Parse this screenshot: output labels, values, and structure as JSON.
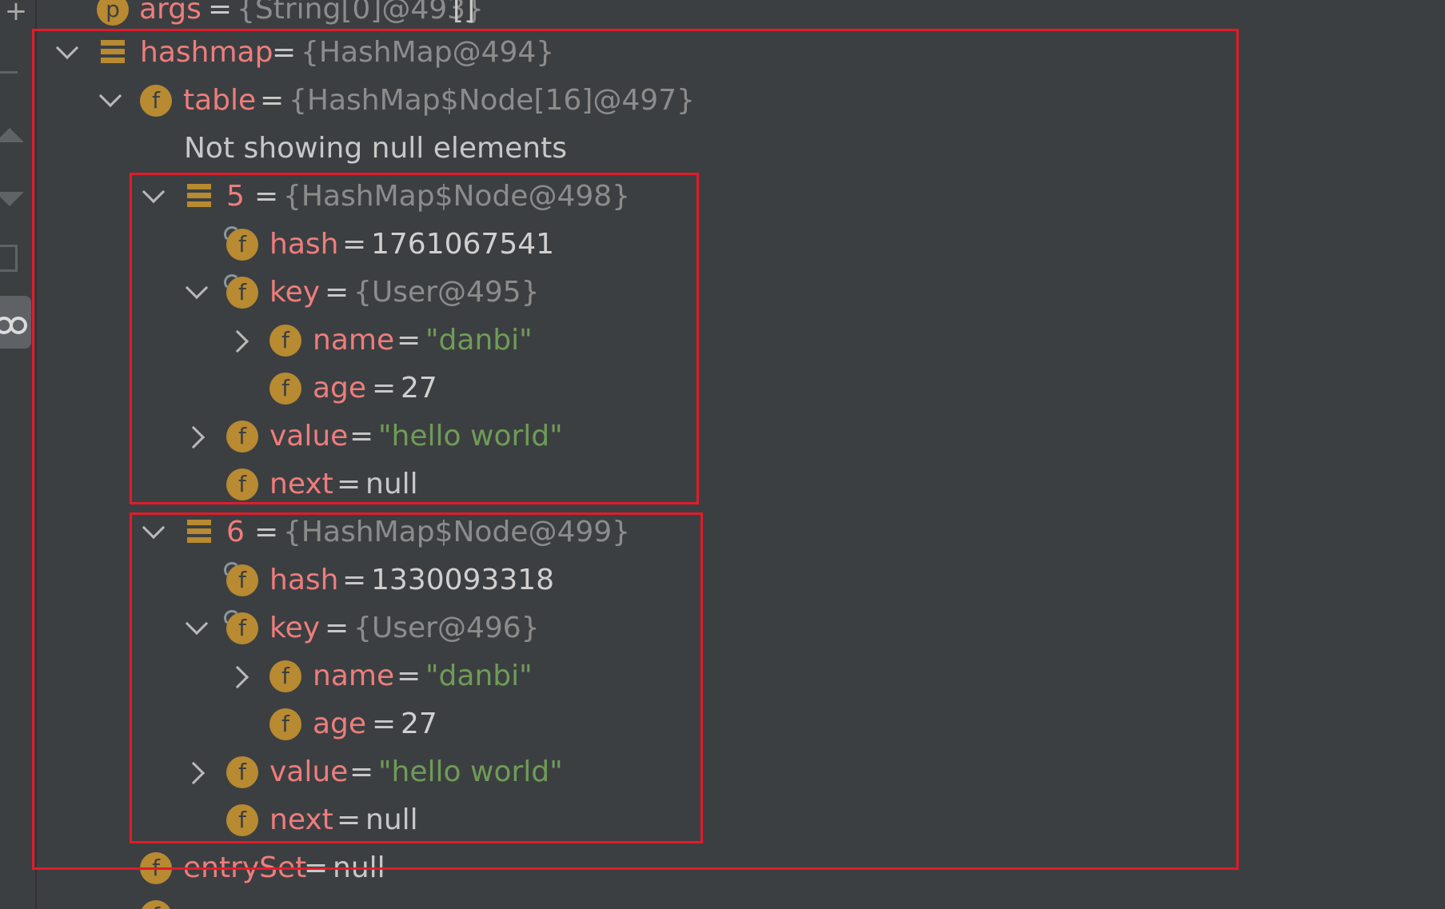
{
  "rows": [
    {
      "name": "args",
      "eq": "=",
      "type": "{String[0]@493}",
      "extra": "[]"
    },
    {
      "name": "hashmap",
      "eq": "=",
      "type": "{HashMap@494}"
    },
    {
      "name": "table",
      "eq": "=",
      "type": "{HashMap$Node[16]@497}"
    },
    {
      "note": "Not showing null elements"
    },
    {
      "name": "5",
      "eq": "=",
      "type": "{HashMap$Node@498}"
    },
    {
      "name": "hash",
      "eq": "=",
      "value": "1761067541"
    },
    {
      "name": "key",
      "eq": "=",
      "type": "{User@495}"
    },
    {
      "name": "name",
      "eq": "=",
      "value": "\"danbi\""
    },
    {
      "name": "age",
      "eq": "=",
      "value": "27"
    },
    {
      "name": "value",
      "eq": "=",
      "value": "\"hello world\""
    },
    {
      "name": "next",
      "eq": "=",
      "value": "null"
    },
    {
      "name": "6",
      "eq": "=",
      "type": "{HashMap$Node@499}"
    },
    {
      "name": "hash",
      "eq": "=",
      "value": "1330093318"
    },
    {
      "name": "key",
      "eq": "=",
      "type": "{User@496}"
    },
    {
      "name": "name",
      "eq": "=",
      "value": "\"danbi\""
    },
    {
      "name": "age",
      "eq": "=",
      "value": "27"
    },
    {
      "name": "value",
      "eq": "=",
      "value": "\"hello world\""
    },
    {
      "name": "next",
      "eq": "=",
      "value": "null"
    },
    {
      "name": "entrySet",
      "eq": "=",
      "value": "null"
    }
  ],
  "icons": {
    "field": "f",
    "param": "p"
  },
  "colors": {
    "background": "#3c3f41",
    "field_name": "#ee7d7d",
    "string_value": "#6f9c56",
    "type_ref": "#8c8c8c",
    "icon_field": "#b88a31",
    "highlight_box": "#e21b2a"
  }
}
